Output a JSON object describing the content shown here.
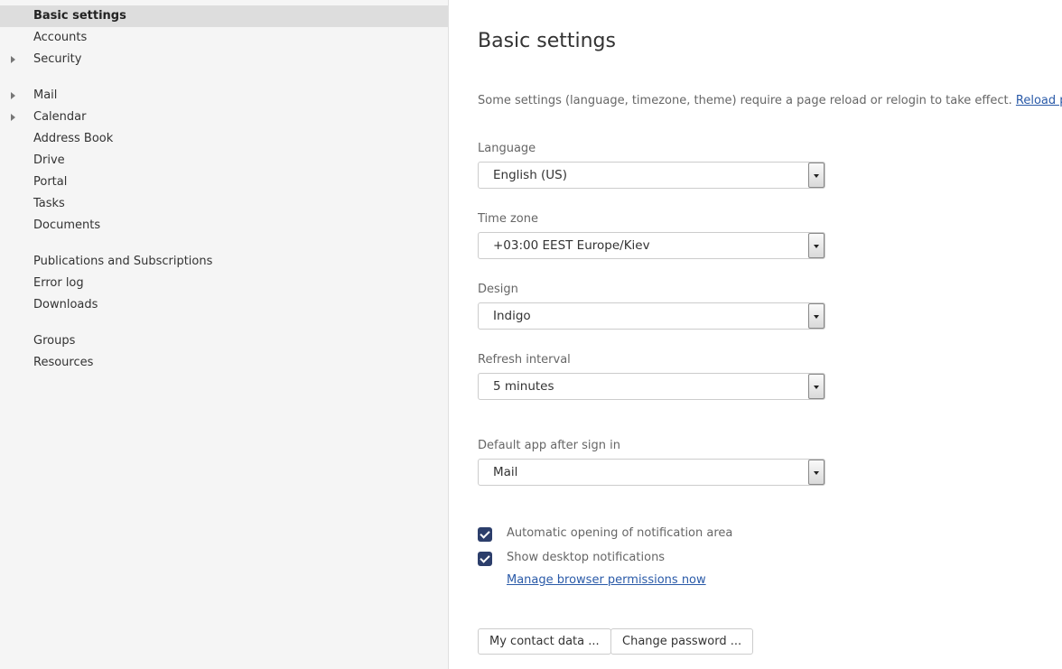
{
  "sidebar": {
    "items": [
      {
        "label": "Basic settings",
        "selected": true,
        "expandable": false
      },
      {
        "label": "Accounts",
        "expandable": false
      },
      {
        "label": "Security",
        "expandable": true
      },
      {
        "label": "Mail",
        "expandable": true
      },
      {
        "label": "Calendar",
        "expandable": true
      },
      {
        "label": "Address Book",
        "expandable": false
      },
      {
        "label": "Drive",
        "expandable": false
      },
      {
        "label": "Portal",
        "expandable": false
      },
      {
        "label": "Tasks",
        "expandable": false
      },
      {
        "label": "Documents",
        "expandable": false
      },
      {
        "label": "Publications and Subscriptions",
        "expandable": false
      },
      {
        "label": "Error log",
        "expandable": false
      },
      {
        "label": "Downloads",
        "expandable": false
      },
      {
        "label": "Groups",
        "expandable": false
      },
      {
        "label": "Resources",
        "expandable": false
      }
    ]
  },
  "main": {
    "title": "Basic settings",
    "notice": "Some settings (language, timezone, theme) require a page reload or relogin to take effect.",
    "reload_link": "Reload page",
    "fields": {
      "language": {
        "label": "Language",
        "value": "English (US)"
      },
      "timezone": {
        "label": "Time zone",
        "value": "+03:00 EEST Europe/Kiev"
      },
      "design": {
        "label": "Design",
        "value": "Indigo"
      },
      "refresh": {
        "label": "Refresh interval",
        "value": "5 minutes"
      },
      "default_app": {
        "label": "Default app after sign in",
        "value": "Mail"
      }
    },
    "checkboxes": {
      "auto_open": {
        "label": "Automatic opening of notification area",
        "checked": true
      },
      "desktop_notifications": {
        "label": "Show desktop notifications",
        "checked": true
      }
    },
    "permissions_link": "Manage browser permissions now",
    "buttons": {
      "contact_data": "My contact data ...",
      "change_password": "Change password ..."
    }
  },
  "colors": {
    "checkbox": "#2c3e6b",
    "link": "#2a5aa8",
    "sidebar_bg": "#f5f5f5",
    "selected_bg": "#dddddd"
  }
}
